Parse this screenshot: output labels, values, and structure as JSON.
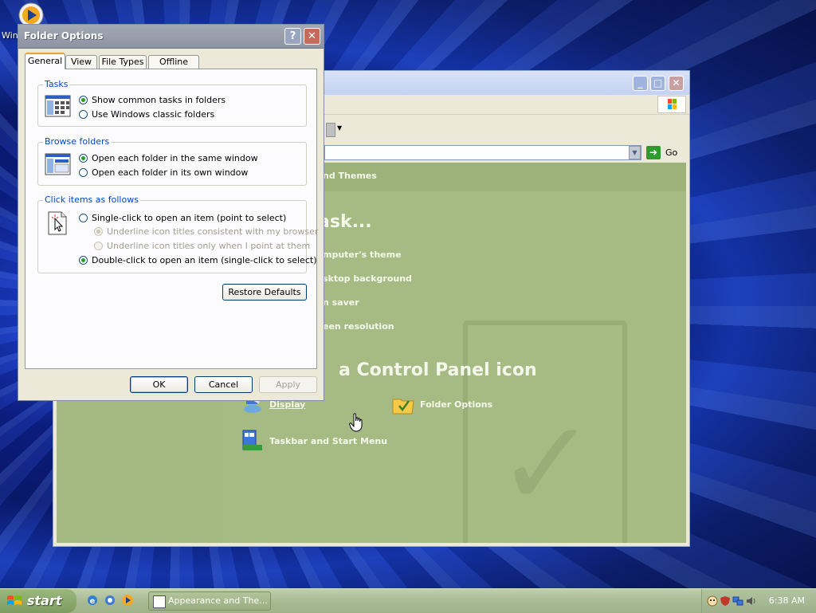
{
  "desktop": {
    "icon_label": "Wind"
  },
  "background_window": {
    "go_label": "Go",
    "header_text": "nd Themes",
    "pick_task": "ask...",
    "tasks": [
      "mputer's theme",
      "sktop background",
      "n saver",
      "een resolution"
    ],
    "or_pick": "a Control Panel icon",
    "icons": [
      {
        "label": "Display",
        "icon": "display-icon"
      },
      {
        "label": "Folder Options",
        "icon": "folder-options-icon"
      },
      {
        "label": "Taskbar and Start Menu",
        "icon": "taskbar-icon"
      }
    ]
  },
  "dialog": {
    "title": "Folder Options",
    "help": "?",
    "close": "✕",
    "tabs": [
      "General",
      "View",
      "File Types",
      "Offline Files"
    ],
    "active_tab": "General",
    "tasks_group": {
      "legend": "Tasks",
      "options": [
        {
          "label": "Show common tasks in folders",
          "checked": true
        },
        {
          "label": "Use Windows classic folders",
          "checked": false
        }
      ]
    },
    "browse_group": {
      "legend": "Browse folders",
      "options": [
        {
          "label": "Open each folder in the same window",
          "checked": true
        },
        {
          "label": "Open each folder in its own window",
          "checked": false
        }
      ]
    },
    "click_group": {
      "legend": "Click items as follows",
      "options": [
        {
          "label": "Single-click to open an item (point to select)",
          "checked": false
        },
        {
          "label": "Underline icon titles consistent with my browser",
          "checked": true,
          "disabled": true
        },
        {
          "label": "Underline icon titles only when I point at them",
          "checked": false,
          "disabled": true
        },
        {
          "label": "Double-click to open an item (single-click to select)",
          "checked": true
        }
      ]
    },
    "restore_defaults": "Restore Defaults",
    "ok": "OK",
    "cancel": "Cancel",
    "apply": "Apply"
  },
  "taskbar": {
    "start_label": "start",
    "task_button": "Appearance and The...",
    "clock": "6:38 AM"
  },
  "colors": {
    "group_legend": "#0046d5",
    "cp_content": "#a6bb84",
    "taskbar": "#a9bb94"
  }
}
